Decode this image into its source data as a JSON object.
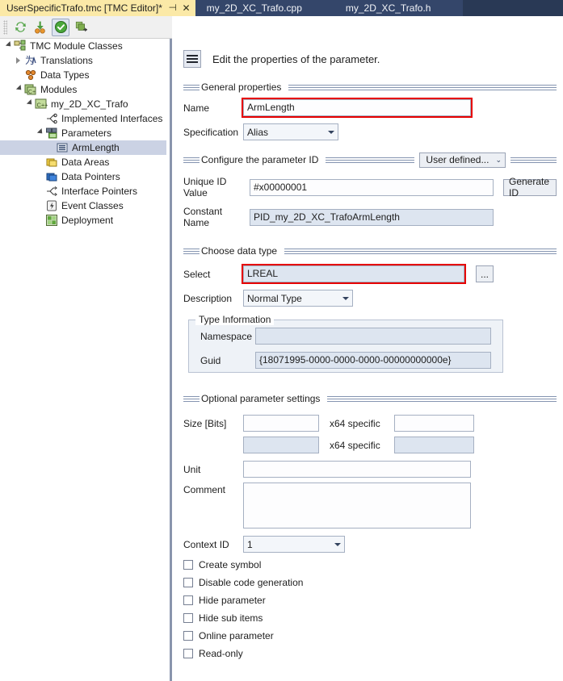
{
  "window": {
    "tabs": [
      {
        "label": "UserSpecificTrafo.tmc [TMC Editor]*",
        "active": true,
        "pin": "⊣",
        "close": "✕"
      },
      {
        "label": "my_2D_XC_Trafo.cpp",
        "active": false
      },
      {
        "label": "my_2D_XC_Trafo.h",
        "active": false
      }
    ]
  },
  "toolbar": {
    "buttons": [
      {
        "name": "refresh-icon",
        "title": "Refresh"
      },
      {
        "name": "import-icon",
        "title": "Import"
      },
      {
        "name": "validate-icon",
        "title": "Validate"
      },
      {
        "name": "copy-module-icon",
        "title": "Copy module"
      }
    ]
  },
  "sidebar": {
    "nodes": [
      {
        "label": "TMC Module Classes",
        "indent": 0,
        "twisty": "expanded",
        "icon": "module-classes-icon",
        "selected": false
      },
      {
        "label": "Translations",
        "indent": 1,
        "twisty": "collapsed",
        "icon": "translations-icon",
        "selected": false
      },
      {
        "label": "Data Types",
        "indent": 1,
        "twisty": "none",
        "icon": "data-types-icon",
        "selected": false
      },
      {
        "label": "Modules",
        "indent": 1,
        "twisty": "expanded",
        "icon": "modules-icon",
        "selected": false
      },
      {
        "label": "my_2D_XC_Trafo",
        "indent": 2,
        "twisty": "expanded",
        "icon": "module-cpp-icon",
        "selected": false
      },
      {
        "label": "Implemented Interfaces",
        "indent": 3,
        "twisty": "none",
        "icon": "interfaces-icon",
        "selected": false
      },
      {
        "label": "Parameters",
        "indent": 3,
        "twisty": "expanded",
        "icon": "parameters-icon",
        "selected": false
      },
      {
        "label": "ArmLength",
        "indent": 4,
        "twisty": "none",
        "icon": "parameter-icon",
        "selected": true
      },
      {
        "label": "Data Areas",
        "indent": 3,
        "twisty": "none",
        "icon": "data-areas-icon",
        "selected": false
      },
      {
        "label": "Data Pointers",
        "indent": 3,
        "twisty": "none",
        "icon": "data-pointers-icon",
        "selected": false
      },
      {
        "label": "Interface Pointers",
        "indent": 3,
        "twisty": "none",
        "icon": "interface-pointers-icon",
        "selected": false
      },
      {
        "label": "Event Classes",
        "indent": 3,
        "twisty": "none",
        "icon": "event-classes-icon",
        "selected": false
      },
      {
        "label": "Deployment",
        "indent": 3,
        "twisty": "none",
        "icon": "deployment-icon",
        "selected": false
      }
    ]
  },
  "main": {
    "page_title": "Edit the properties of the parameter.",
    "general": {
      "group_title": "General properties",
      "name_label": "Name",
      "name_value": "ArmLength",
      "specification_label": "Specification",
      "specification_value": "Alias"
    },
    "parameter_id": {
      "group_title": "Configure the parameter ID",
      "mode_value": "User defined...",
      "unique_id_label": "Unique ID Value",
      "unique_id_value": "#x00000001",
      "generate_id_label": "Generate ID",
      "constant_name_label": "Constant Name",
      "constant_name_value": "PID_my_2D_XC_TrafoArmLength"
    },
    "data_type": {
      "group_title": "Choose data type",
      "select_label": "Select",
      "select_value": "LREAL",
      "browse_label": "...",
      "description_label": "Description",
      "description_value": "Normal Type",
      "type_information": {
        "legend": "Type Information",
        "namespace_label": "Namespace",
        "namespace_value": "",
        "guid_label": "Guid",
        "guid_value": "{18071995-0000-0000-0000-00000000000e}"
      }
    },
    "optional": {
      "group_title": "Optional parameter settings",
      "size_bits_label": "Size [Bits]",
      "size_bits_value": "",
      "x64_specific_label_1": "x64 specific",
      "x64_specific_value_1": "",
      "size_bits_alt_value": "",
      "x64_specific_label_2": "x64 specific",
      "x64_specific_value_2": "",
      "unit_label": "Unit",
      "unit_value": "",
      "comment_label": "Comment",
      "comment_value": "",
      "context_id_label": "Context ID",
      "context_id_value": "1",
      "checkboxes": [
        {
          "label": "Create symbol",
          "checked": false,
          "name": "create-symbol"
        },
        {
          "label": "Disable code generation",
          "checked": false,
          "name": "disable-code-generation"
        },
        {
          "label": "Hide parameter",
          "checked": false,
          "name": "hide-parameter"
        },
        {
          "label": "Hide sub items",
          "checked": false,
          "name": "hide-sub-items"
        },
        {
          "label": "Online parameter",
          "checked": false,
          "name": "online-parameter"
        },
        {
          "label": "Read-only",
          "checked": false,
          "name": "read-only"
        }
      ]
    }
  },
  "colors": {
    "tab_active_bg": "#fbe9a7",
    "tabstrip_bg": "#293955",
    "tab_inactive_bg": "#34466a",
    "highlight_red": "#e60000",
    "selection_bg": "#cbd2e4",
    "readonly_field_bg": "#dde5f0"
  }
}
